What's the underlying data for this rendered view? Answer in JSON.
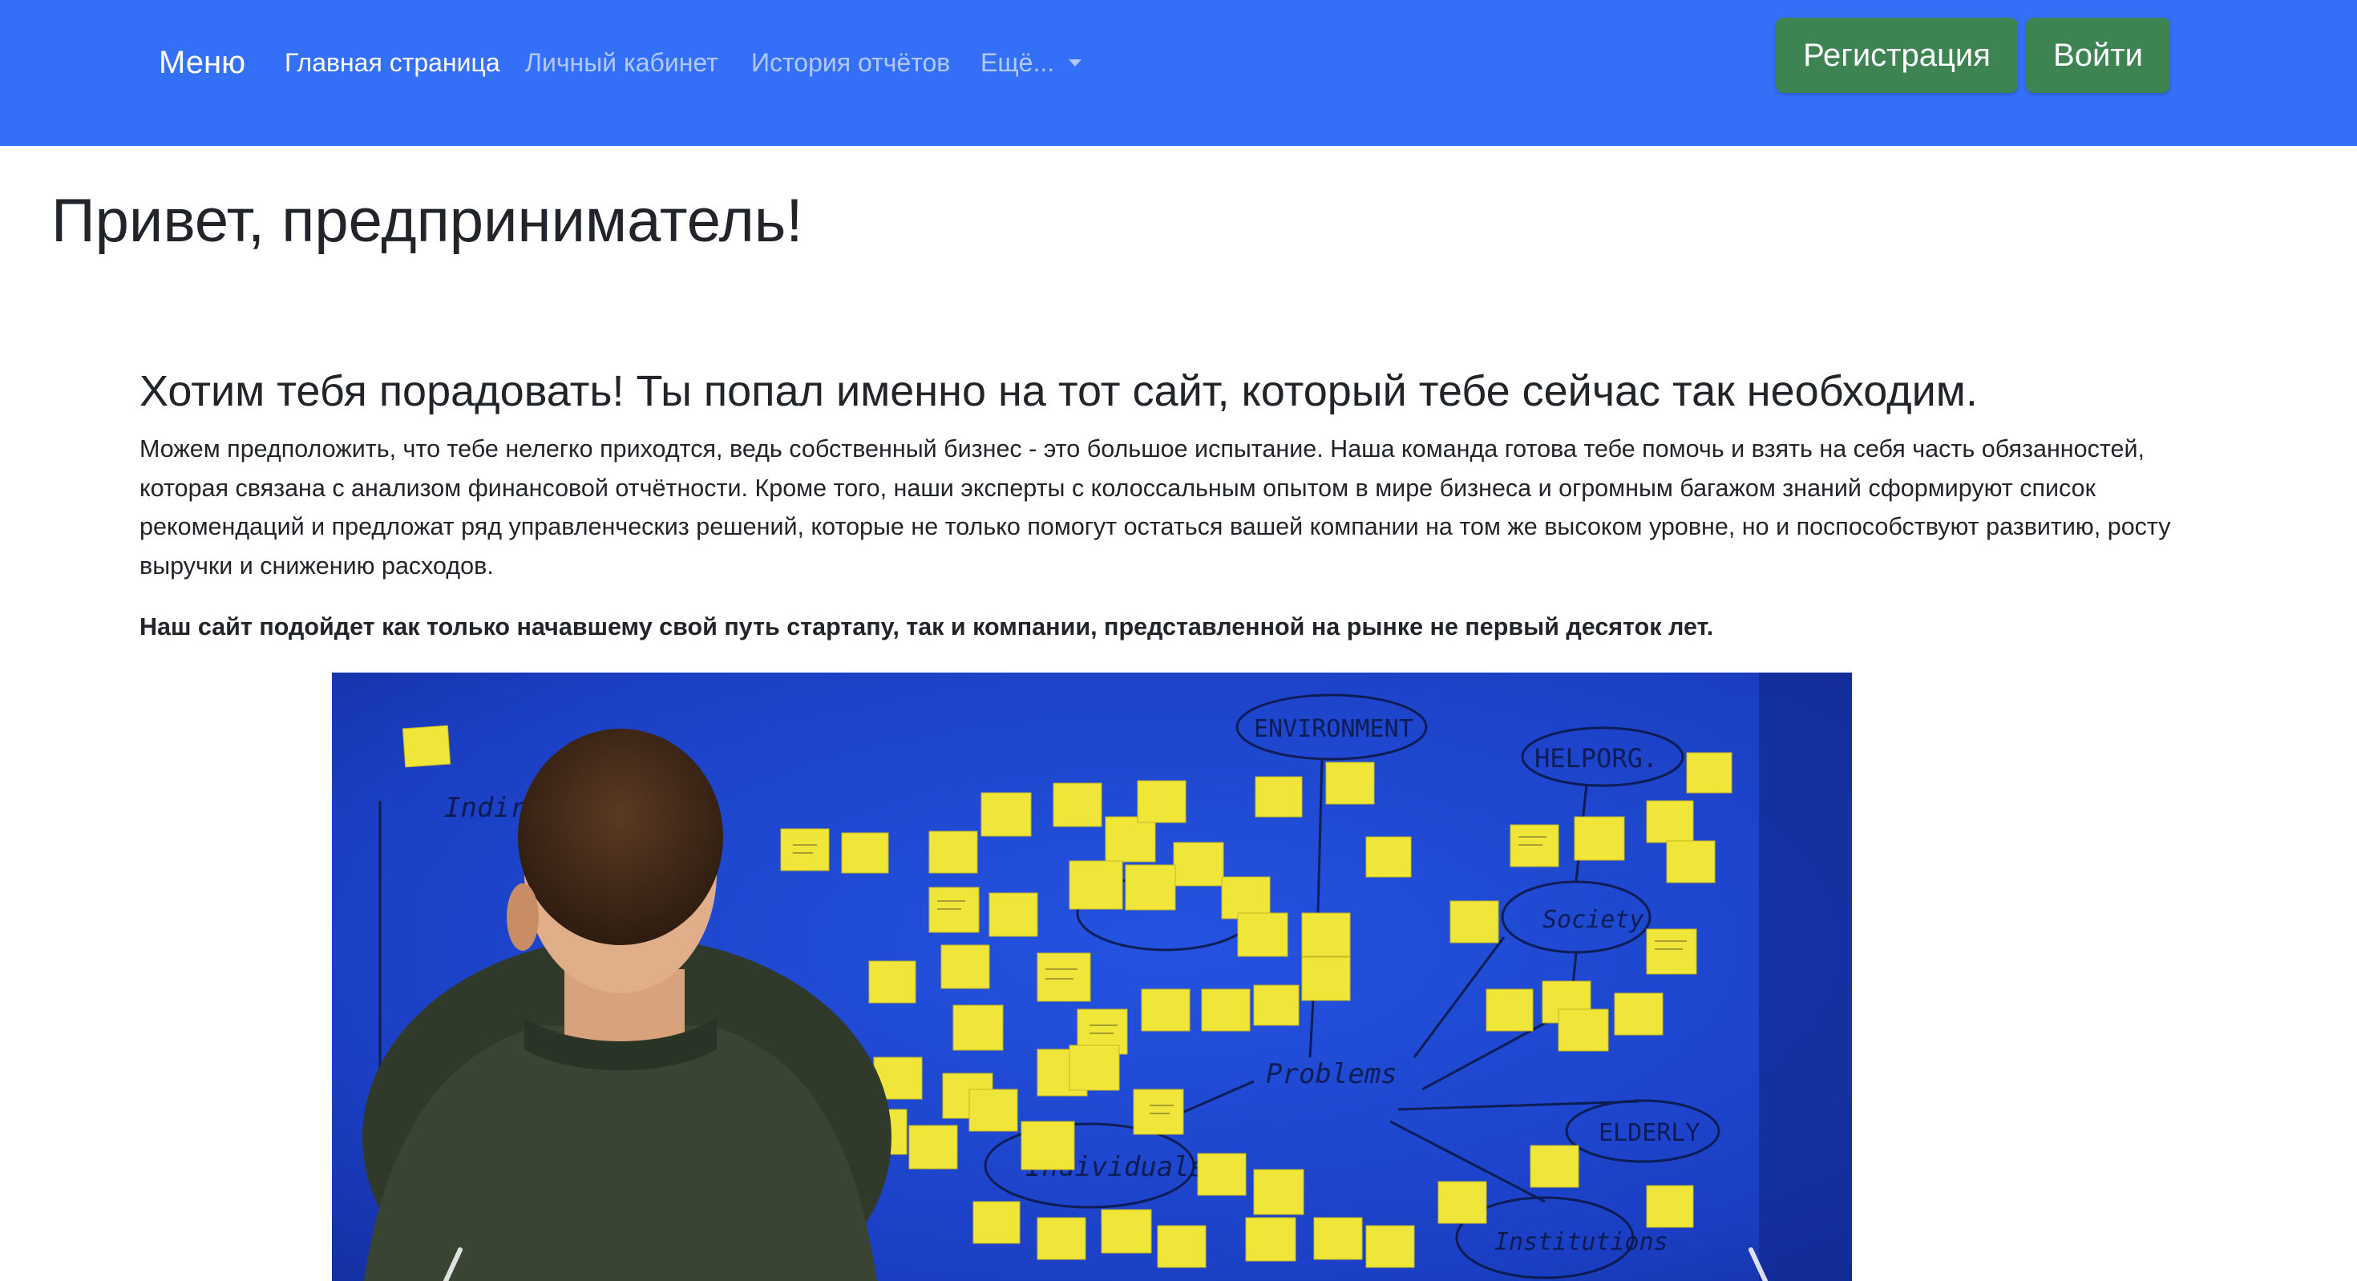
{
  "navbar": {
    "brand": "Меню",
    "links": [
      {
        "label": "Главная страница",
        "active": true
      },
      {
        "label": "Личный кабинет",
        "active": false
      },
      {
        "label": "История отчётов",
        "active": false
      },
      {
        "label": "Ещё...",
        "active": false,
        "icon": "caret-down-icon"
      }
    ],
    "register_label": "Регистрация",
    "login_label": "Войти",
    "bg_color": "#3370f7",
    "button_color": "#3e8453"
  },
  "main": {
    "title": "Привет, предприниматель!",
    "subtitle": "Хотим тебя порадовать! Ты попал именно на тот сайт, который тебе сейчас так необходим.",
    "paragraph": "Можем предположить, что тебе нелегко приходтся, ведь собственный бизнес - это большое испытание. Наша команда готова тебе помочь и взять на себя часть обязанностей, которая связана с анализом финансовой отчётности. Кроме того, наши эксперты с колоссальным опытом в мире бизнеса и огромным багажом знаний сформируют список рекомендаций и предложат ряд управленческиз решений, которые не только помогут остаться вашей компании на том же высоком уровне, но и поспособствуют развитию, росту выручки и снижению расходов.",
    "bold_paragraph": "Наш сайт подойдет как только начавшему свой путь стартапу, так и компании, представленной на рынке не первый десяток лет."
  },
  "carousel": {
    "image_labels": [
      "ENVIRONMENT",
      "HELPORG.",
      "Indirect",
      "Society",
      "Problems",
      "Individuals",
      "ELDERLY",
      "Institutions"
    ],
    "prev_icon": "chevron-left-icon",
    "next_icon": "chevron-right-icon"
  }
}
